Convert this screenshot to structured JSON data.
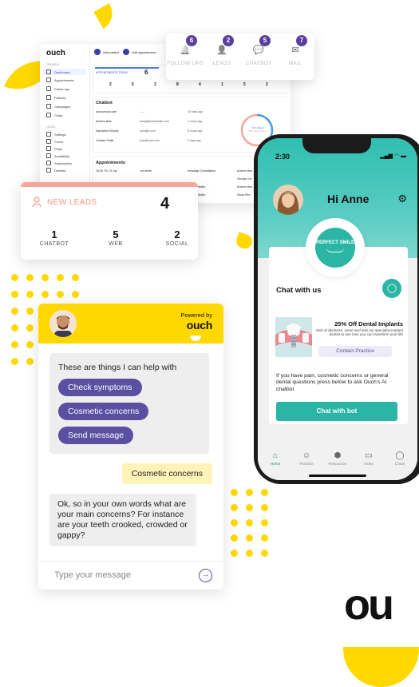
{
  "dashboard": {
    "logo": "ouch",
    "add_patient": "Add patient",
    "add_appointment": "Add appointment",
    "sections": [
      "GENERAL",
      "LEADS"
    ],
    "nav_general": [
      "Dashboard",
      "Appointments",
      "Follow ups",
      "Patients",
      "Campaigns",
      "Chats"
    ],
    "nav_leads": [
      "Settings",
      "Forms",
      "FAQs",
      "Availability",
      "Subscription",
      "Dentists"
    ],
    "appointments_today_label": "APPOINTMENTS TODAY",
    "appointments_today_value": "6",
    "stats": [
      "2",
      "5",
      "3",
      "8",
      "4",
      "1",
      "5",
      "2"
    ],
    "chatbot_title": "Chatbot",
    "chatbot_rows": [
      {
        "name": "Anonymous user",
        "email": "-----",
        "time": "15 mins ago"
      },
      {
        "name": "Andrew Bain",
        "email": "andy@andrewbain.com",
        "time": "1 hours ago"
      },
      {
        "name": "Samantha Shipley",
        "email": "sam@ft.com",
        "time": "5 hours ago"
      },
      {
        "name": "Jonthan Smith",
        "email": "jons@inner.com",
        "time": "2 days ago"
      }
    ],
    "donut_labels": [
      "34% Patient",
      "66% Anonymous"
    ],
    "appointments_title": "Appointments",
    "appointments_rows": [
      {
        "date": "16:00, Fri, 21 Apr",
        "name": "Jon smith",
        "type": "Invisalign Consultation",
        "with": "Andrew Bea"
      },
      {
        "date": "",
        "name": "",
        "type": "",
        "with": "George Cre"
      },
      {
        "date": "",
        "name": "",
        "type": "n Consultation",
        "with": "Andrew Bea"
      },
      {
        "date": "",
        "name": "",
        "type": "n Consultation",
        "with": "Sarah Bea"
      }
    ]
  },
  "notifications": [
    {
      "label": "FOLLOW UPS",
      "count": "6",
      "icon": "bell-icon",
      "glyph": "🔔"
    },
    {
      "label": "LEADS",
      "count": "2",
      "icon": "person-icon",
      "glyph": "👤"
    },
    {
      "label": "CHATBOT",
      "count": "5",
      "icon": "chat-icon",
      "glyph": "💬"
    },
    {
      "label": "MAIL",
      "count": "7",
      "icon": "mail-icon",
      "glyph": "✉"
    }
  ],
  "leads": {
    "title": "NEW LEADS",
    "total": "4",
    "stats": [
      {
        "value": "1",
        "label": "CHATBOT"
      },
      {
        "value": "5",
        "label": "WEB"
      },
      {
        "value": "2",
        "label": "SOCIAL"
      }
    ]
  },
  "chatbot": {
    "powered_by": "Powered by",
    "brand": "ouch",
    "intro": "These are things I can help with",
    "options": [
      "Check symptoms",
      "Cosmetic concerns",
      "Send message"
    ],
    "user_reply": "Cosmetic concerns",
    "bot_reply": "Ok, so in your own words what are your main concerns? For instance are your teeth crooked, crowded or gappy?",
    "input_placeholder": "Type your message"
  },
  "phone": {
    "time": "2:30",
    "greeting": "Hi Anne",
    "logo_text": "PERFECT SMILE",
    "chat_with_us": "Chat with us",
    "promo_title": "25% Off Dental Implants",
    "promo_desc": "Sick of dentures, come and visit our specialist implant dentist to see how you can transform your life",
    "contact_btn": "Contact Practice",
    "pain_text": "If you have pain, cosmetic concerns or general dental questions press below to ask Ouch's AI chatbot",
    "chat_btn": "Chat with bot",
    "tabs": [
      {
        "label": "Home",
        "icon": "home-icon",
        "glyph": "⌂"
      },
      {
        "label": "Practice",
        "icon": "people-icon",
        "glyph": "☺"
      },
      {
        "label": "Resources",
        "icon": "cap-icon",
        "glyph": "⬢"
      },
      {
        "label": "Video",
        "icon": "video-icon",
        "glyph": "▭"
      },
      {
        "label": "Chats",
        "icon": "chats-icon",
        "glyph": "◯"
      }
    ]
  },
  "brand_mark": "ou",
  "colors": {
    "yellow": "#ffd800",
    "teal": "#2ab5a5",
    "purple": "#5a4fa0",
    "coral": "#f09785"
  }
}
